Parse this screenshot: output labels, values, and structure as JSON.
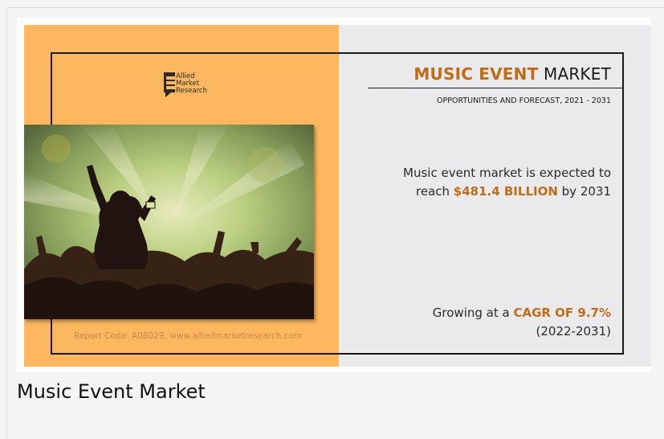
{
  "infographic": {
    "logo": {
      "line1": "Allied",
      "line2": "Market",
      "line3": "Research"
    },
    "report_code": "Report Code: A08029, www.alliedmarketresearch.com",
    "title": {
      "accent": "MUSIC EVENT",
      "rest": " MARKET"
    },
    "subtitle": "OPPORTUNITIES AND FORECAST, 2021 - 2031",
    "fact1": {
      "line1": "Music event market is expected to",
      "prefix": "reach ",
      "highlight": "$481.4 BILLION",
      "suffix": " by 2031"
    },
    "fact2": {
      "prefix": "Growing at a ",
      "highlight": "CAGR OF 9.7%",
      "line2": "(2022-2031)"
    },
    "photo_alt": "concert crowd"
  },
  "caption": "Music Event Market",
  "colors": {
    "orange_panel": "#fcb75f",
    "accent": "#bf6d19",
    "gray_panel": "#eaeaec"
  }
}
